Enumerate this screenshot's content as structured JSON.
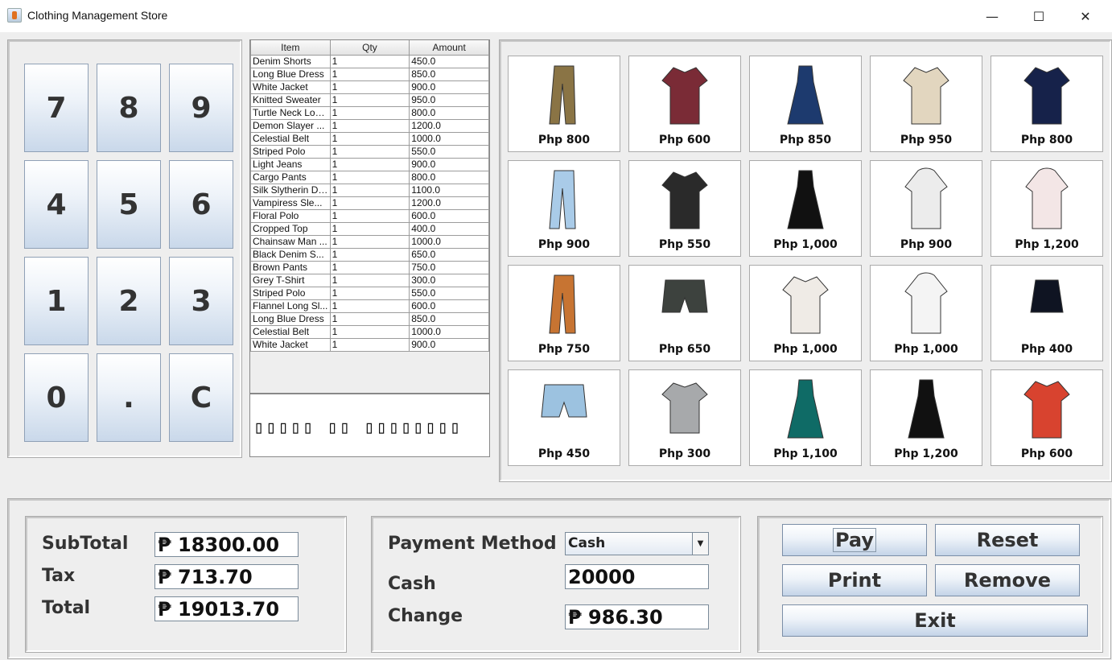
{
  "window": {
    "title": "Clothing Management Store",
    "minimize": "—",
    "maximize": "☐",
    "close": "✕"
  },
  "keypad": {
    "keys": [
      "7",
      "8",
      "9",
      "4",
      "5",
      "6",
      "1",
      "2",
      "3",
      "0",
      ".",
      "C"
    ]
  },
  "order_table": {
    "headers": [
      "Item",
      "Qty",
      "Amount"
    ],
    "rows": [
      [
        "Denim Shorts",
        "1",
        "450.0"
      ],
      [
        "Long Blue Dress",
        "1",
        "850.0"
      ],
      [
        "White Jacket",
        "1",
        "900.0"
      ],
      [
        "Knitted Sweater",
        "1",
        "950.0"
      ],
      [
        "Turtle Neck Lon...",
        "1",
        "800.0"
      ],
      [
        "Demon Slayer ...",
        "1",
        "1200.0"
      ],
      [
        "Celestial Belt",
        "1",
        "1000.0"
      ],
      [
        "Striped Polo",
        "1",
        "550.0"
      ],
      [
        "Light Jeans",
        "1",
        "900.0"
      ],
      [
        "Cargo Pants",
        "1",
        "800.0"
      ],
      [
        "Silk Slytherin Dr...",
        "1",
        "1100.0"
      ],
      [
        "Vampiress Sle...",
        "1",
        "1200.0"
      ],
      [
        "Floral Polo",
        "1",
        "600.0"
      ],
      [
        "Cropped Top",
        "1",
        "400.0"
      ],
      [
        "Chainsaw Man ...",
        "1",
        "1000.0"
      ],
      [
        "Black Denim S...",
        "1",
        "650.0"
      ],
      [
        "Brown Pants",
        "1",
        "750.0"
      ],
      [
        "Grey T-Shirt",
        "1",
        "300.0"
      ],
      [
        "Striped Polo",
        "1",
        "550.0"
      ],
      [
        "Flannel Long Sl...",
        "1",
        "600.0"
      ],
      [
        "Long Blue Dress",
        "1",
        "850.0"
      ],
      [
        "Celestial Belt",
        "1",
        "1000.0"
      ],
      [
        "White Jacket",
        "1",
        "900.0"
      ]
    ]
  },
  "marquee": {
    "text": "▯▯▯▯▯ ▯▯ ▯▯▯▯▯▯▯▯"
  },
  "products": [
    {
      "price": "Php 800",
      "icon": "cargo-pants-icon",
      "color": "#8a7445"
    },
    {
      "price": "Php 600",
      "icon": "flannel-shirt-icon",
      "color": "#7a2b36"
    },
    {
      "price": "Php 850",
      "icon": "long-blue-dress-icon",
      "color": "#1d3a6e"
    },
    {
      "price": "Php 950",
      "icon": "knitted-sweater-icon",
      "color": "#e2d6bf"
    },
    {
      "price": "Php 800",
      "icon": "turtle-neck-icon",
      "color": "#16224a"
    },
    {
      "price": "Php 900",
      "icon": "light-jeans-icon",
      "color": "#a9cbe8"
    },
    {
      "price": "Php 550",
      "icon": "striped-polo-icon",
      "color": "#2a2a2a"
    },
    {
      "price": "Php 1,000",
      "icon": "black-dress-belt-icon",
      "color": "#111111"
    },
    {
      "price": "Php 900",
      "icon": "white-jacket-icon",
      "color": "#ececec"
    },
    {
      "price": "Php 1,200",
      "icon": "demon-slayer-hoodie-icon",
      "color": "#f3e6e6"
    },
    {
      "price": "Php 750",
      "icon": "brown-pants-icon",
      "color": "#c77432"
    },
    {
      "price": "Php 650",
      "icon": "black-denim-shorts-icon",
      "color": "#3d423e"
    },
    {
      "price": "Php 1,000",
      "icon": "white-blouse-icon",
      "color": "#efebe6"
    },
    {
      "price": "Php 1,000",
      "icon": "chainsaw-man-hoodie-icon",
      "color": "#f4f4f4"
    },
    {
      "price": "Php 400",
      "icon": "cropped-top-icon",
      "color": "#0f1422"
    },
    {
      "price": "Php 450",
      "icon": "denim-shorts-icon",
      "color": "#9cc2e0"
    },
    {
      "price": "Php 300",
      "icon": "grey-tshirt-icon",
      "color": "#a7a9ab"
    },
    {
      "price": "Php 1,100",
      "icon": "silk-green-dress-icon",
      "color": "#0f6b66"
    },
    {
      "price": "Php 1,200",
      "icon": "vampiress-dress-icon",
      "color": "#111111"
    },
    {
      "price": "Php 600",
      "icon": "floral-polo-icon",
      "color": "#d8432f"
    }
  ],
  "totals": {
    "subtotal_label": "SubTotal",
    "subtotal": "₱ 18300.00",
    "tax_label": "Tax",
    "tax": "₱ 713.70",
    "total_label": "Total",
    "total": "₱ 19013.70"
  },
  "payment": {
    "method_label": "Payment Method",
    "method": "Cash",
    "cash_label": "Cash",
    "cash": "20000",
    "change_label": "Change",
    "change": "₱ 986.30"
  },
  "actions": {
    "pay": "Pay",
    "reset": "Reset",
    "print": "Print",
    "remove": "Remove",
    "exit": "Exit"
  }
}
